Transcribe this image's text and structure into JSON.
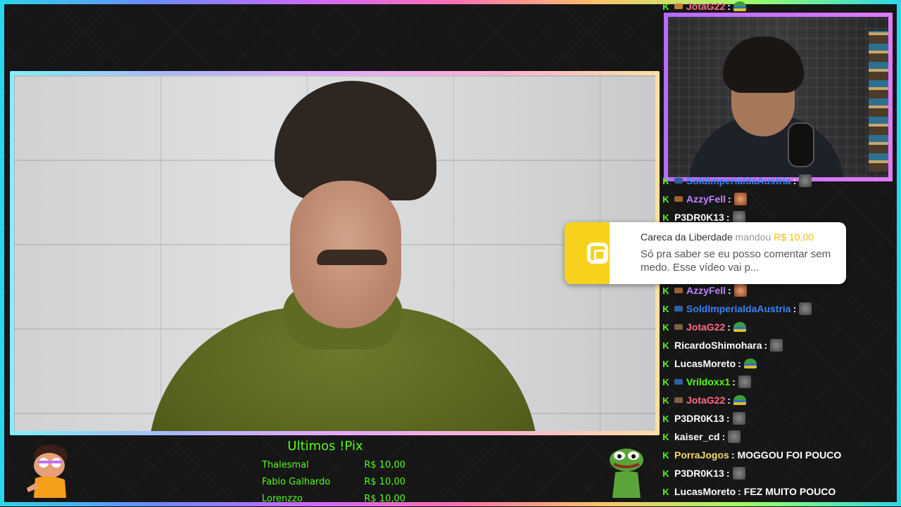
{
  "chat": {
    "messages": [
      {
        "user": "JotaG22",
        "color": "#ff6b8a",
        "badge": "#c08040",
        "emote": "hat",
        "text": ""
      },
      {
        "user": "SoldImperialdaAustria",
        "color": "#3b82f6",
        "badge": "#3060a0",
        "emote": "gray",
        "text": ""
      },
      {
        "user": "AzzyFell",
        "color": "#c084fc",
        "badge": "#a06030",
        "emote": "orange",
        "text": ""
      },
      {
        "user": "P3DR0K13",
        "color": "#ffffff",
        "badge": "",
        "emote": "gray",
        "text": ""
      },
      {
        "user": "AzzyFell",
        "color": "#c084fc",
        "badge": "#a06030",
        "emote": "orange",
        "text": ""
      },
      {
        "user": "SoldImperialdaAustria",
        "color": "#3b82f6",
        "badge": "#3060a0",
        "emote": "gray",
        "text": ""
      },
      {
        "user": "JotaG22",
        "color": "#ff6b8a",
        "badge": "#806040",
        "emote": "hat",
        "text": ""
      },
      {
        "user": "RicardoShimohara",
        "color": "#ffffff",
        "badge": "",
        "emote": "gray",
        "text": ""
      },
      {
        "user": "LucasMoreto",
        "color": "#ffffff",
        "badge": "",
        "emote": "hat",
        "text": ""
      },
      {
        "user": "Vrildoxx1",
        "color": "#53fc18",
        "badge": "#3060a0",
        "emote": "gray",
        "text": ""
      },
      {
        "user": "JotaG22",
        "color": "#ff6b8a",
        "badge": "#806040",
        "emote": "hat",
        "text": ""
      },
      {
        "user": "P3DR0K13",
        "color": "#ffffff",
        "badge": "",
        "emote": "gray",
        "text": ""
      },
      {
        "user": "kaiser_cd",
        "color": "#ffffff",
        "badge": "",
        "emote": "gray",
        "text": ""
      },
      {
        "user": "PorraJogos",
        "color": "#f5d76e",
        "badge": "",
        "emote": "",
        "text": "MOGGOU FOI POUCO"
      },
      {
        "user": "P3DR0K13",
        "color": "#ffffff",
        "badge": "",
        "emote": "gray",
        "text": ""
      },
      {
        "user": "LucasMoreto",
        "color": "#ffffff",
        "badge": "",
        "emote": "",
        "text": "FEZ MUITO POUCO"
      }
    ]
  },
  "pix_alert": {
    "name": "Careca da Liberdade",
    "verb": "mandou",
    "amount": "R$ 10,00",
    "message": "Só pra saber se eu posso comentar sem medo. Esse vídeo vai p..."
  },
  "pix_list": {
    "title": "Ultimos !Pix",
    "rows": [
      {
        "name": "Thalesmal",
        "amount": "R$ 10,00"
      },
      {
        "name": "Fabio Galhardo",
        "amount": "R$ 10,00"
      },
      {
        "name": "Lorenzzo",
        "amount": "R$ 10,00"
      }
    ]
  },
  "colors": {
    "kick_green": "#53fc18",
    "pix_yellow": "#f7d21c",
    "background": "#161616"
  }
}
